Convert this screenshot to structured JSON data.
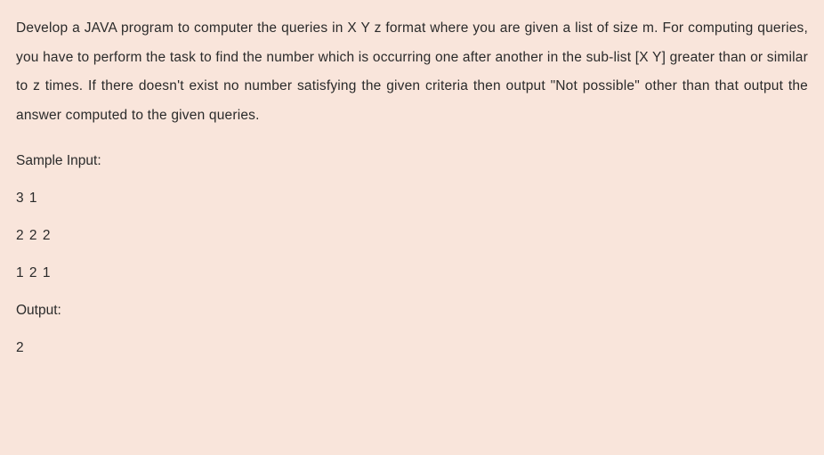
{
  "problem": {
    "description": "Develop a JAVA program to computer the queries in X Y z format where you are given a list of size m. For computing queries, you have to perform the task to find the number which is occurring one after another in the sub-list [X Y] greater than or similar to z times. If there doesn't exist no number satisfying the given criteria then output \"Not possible\" other than that output the answer computed to the given queries."
  },
  "sampleInput": {
    "label": "Sample Input:",
    "lines": [
      "3 1",
      "2 2 2",
      "1 2 1"
    ]
  },
  "output": {
    "label": "Output:",
    "lines": [
      "2"
    ]
  }
}
